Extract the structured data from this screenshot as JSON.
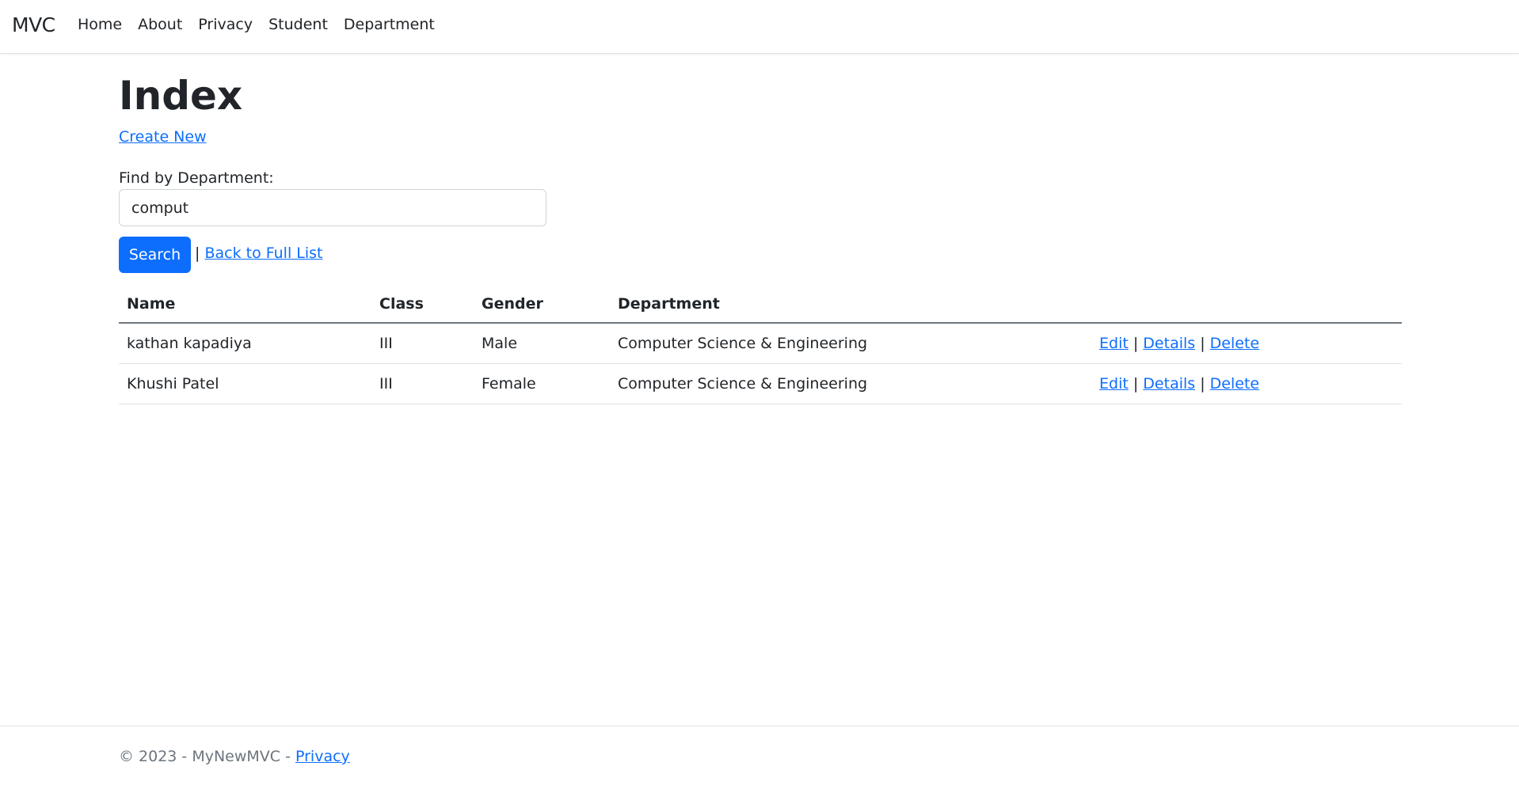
{
  "navbar": {
    "brand": "MVC",
    "links": [
      "Home",
      "About",
      "Privacy",
      "Student",
      "Department"
    ]
  },
  "page": {
    "title": "Index",
    "create_new": "Create New",
    "find_label": "Find by Department:",
    "search_value": "comput",
    "search_button": "Search",
    "separator": "|",
    "back_link": "Back to Full List"
  },
  "table": {
    "headers": [
      "Name",
      "Class",
      "Gender",
      "Department",
      ""
    ],
    "rows": [
      {
        "name": "kathan kapadiya",
        "class": "III",
        "gender": "Male",
        "department": "Computer Science & Engineering"
      },
      {
        "name": "Khushi Patel",
        "class": "III",
        "gender": "Female",
        "department": "Computer Science & Engineering"
      }
    ],
    "actions": {
      "edit": "Edit",
      "details": "Details",
      "delete": "Delete",
      "sep": "|"
    }
  },
  "footer": {
    "text": "© 2023 - MyNewMVC - ",
    "privacy": "Privacy"
  },
  "colors": {
    "link": "#0d6efd",
    "button": "#0d6efd",
    "text": "#212529",
    "muted": "#6c757d"
  }
}
